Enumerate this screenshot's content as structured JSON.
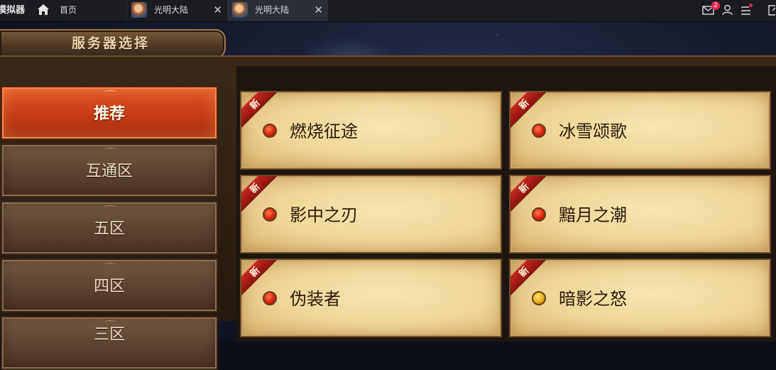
{
  "window": {
    "app_title": "模拟器",
    "home_tab_label": "首页",
    "tabs": [
      {
        "label": "光明大陆",
        "close": "✕"
      },
      {
        "label": "光明大陆",
        "close": "✕"
      }
    ],
    "mail_badge_count": "2",
    "icons": [
      "home-icon",
      "mail-icon",
      "user-icon",
      "menu-icon",
      "window-icon"
    ]
  },
  "game": {
    "panel_title": "服务器选择",
    "categories": [
      {
        "label": "推荐",
        "active": true
      },
      {
        "label": "互通区",
        "active": false
      },
      {
        "label": "五区",
        "active": false
      },
      {
        "label": "四区",
        "active": false
      },
      {
        "label": "三区",
        "active": false
      }
    ],
    "servers": [
      {
        "name": "燃烧征途",
        "badge": "新",
        "status": "red"
      },
      {
        "name": "冰雪颂歌",
        "badge": "新",
        "status": "red"
      },
      {
        "name": "影中之刃",
        "badge": "新",
        "status": "red"
      },
      {
        "name": "黯月之潮",
        "badge": "新",
        "status": "red"
      },
      {
        "name": "伪装者",
        "badge": "新",
        "status": "red"
      },
      {
        "name": "暗影之怒",
        "badge": "新",
        "status": "yellow"
      }
    ],
    "colors": {
      "active_category": "#c43b15",
      "status_red": "#d6260e",
      "status_yellow": "#e9b016",
      "ribbon": "#b0211a"
    }
  }
}
